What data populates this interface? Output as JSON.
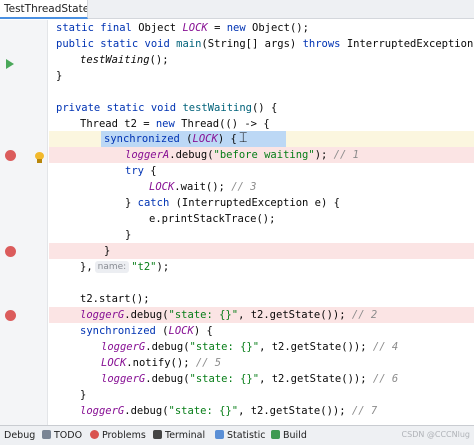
{
  "tab": {
    "label": "TestThreadState.java"
  },
  "hint": {
    "name_label": "name:"
  },
  "code": {
    "l1": {
      "mods": "static final",
      "type": "Object",
      "field": "LOCK",
      "assign": " = ",
      "kw_new": "new",
      "rest": " Object();"
    },
    "l2": {
      "mods": "public static void",
      "method": "main",
      "params": "(String[] args) ",
      "kw_throws": "throws",
      "rest": " InterruptedException {"
    },
    "l3": {
      "method": "testWaiting",
      "rest": "();"
    },
    "l4": {
      "text": "}"
    },
    "l6": {
      "mods": "private static void",
      "method": "testWaiting",
      "rest": "() {"
    },
    "l7": {
      "pre": "Thread t2 = ",
      "kw_new": "new",
      "rest": " Thread(() -> {"
    },
    "l8": {
      "kw": "synchronized",
      "open": " (",
      "field": "LOCK",
      "close": ") {"
    },
    "l9": {
      "field": "loggerA",
      "call": ".debug(",
      "str": "\"before waiting\"",
      "end": ");",
      "comment": " // 1"
    },
    "l10": {
      "kw": "try",
      "rest": " {"
    },
    "l11": {
      "field": "LOCK",
      "call": ".wait();",
      "comment": " // 3"
    },
    "l12": {
      "pre": "} ",
      "kw": "catch",
      "rest": " (InterruptedException e) {"
    },
    "l13": {
      "text": "e.printStackTrace();"
    },
    "l14": {
      "text": "}"
    },
    "l15": {
      "text": "}"
    },
    "l16": {
      "pre": "},",
      "str": "\"t2\"",
      "end": ");"
    },
    "l18": {
      "text": "t2.start();"
    },
    "l19": {
      "field": "loggerG",
      "call": ".debug(",
      "str": "\"state: {}\"",
      "end": ", t2.getState());",
      "comment": " // 2"
    },
    "l20": {
      "kw": "synchronized",
      "open": " (",
      "field": "LOCK",
      "close": ") {"
    },
    "l21": {
      "field": "loggerG",
      "call": ".debug(",
      "str": "\"state: {}\"",
      "end": ", t2.getState());",
      "comment": " // 4"
    },
    "l22": {
      "field": "LOCK",
      "call": ".notify();",
      "comment": " // 5"
    },
    "l23": {
      "field": "loggerG",
      "call": ".debug(",
      "str": "\"state: {}\"",
      "end": ", t2.getState());",
      "comment": " // 6"
    },
    "l24": {
      "text": "}"
    },
    "l25": {
      "field": "loggerG",
      "call": ".debug(",
      "str": "\"state: {}\"",
      "end": ", t2.getState());",
      "comment": " // 7"
    }
  },
  "statusbar": {
    "debug": "Debug",
    "todo": "TODO",
    "problems": "Problems",
    "terminal": "Terminal",
    "statistic": "Statistic",
    "build": "Build",
    "watermark": "CSDN @CCCNlug"
  },
  "colors": {
    "keyword": "#0033b3",
    "method": "#00627a",
    "field": "#871094",
    "string": "#067d17",
    "comment": "#8c8c8c",
    "breakpoint": "#db5c5c",
    "breakpoint_line": "#fbe4e4",
    "selection": "#bcd8f5"
  },
  "icons": [
    "run-gutter-icon",
    "breakpoint-icon",
    "intention-bulb-icon",
    "text-cursor-icon"
  ]
}
